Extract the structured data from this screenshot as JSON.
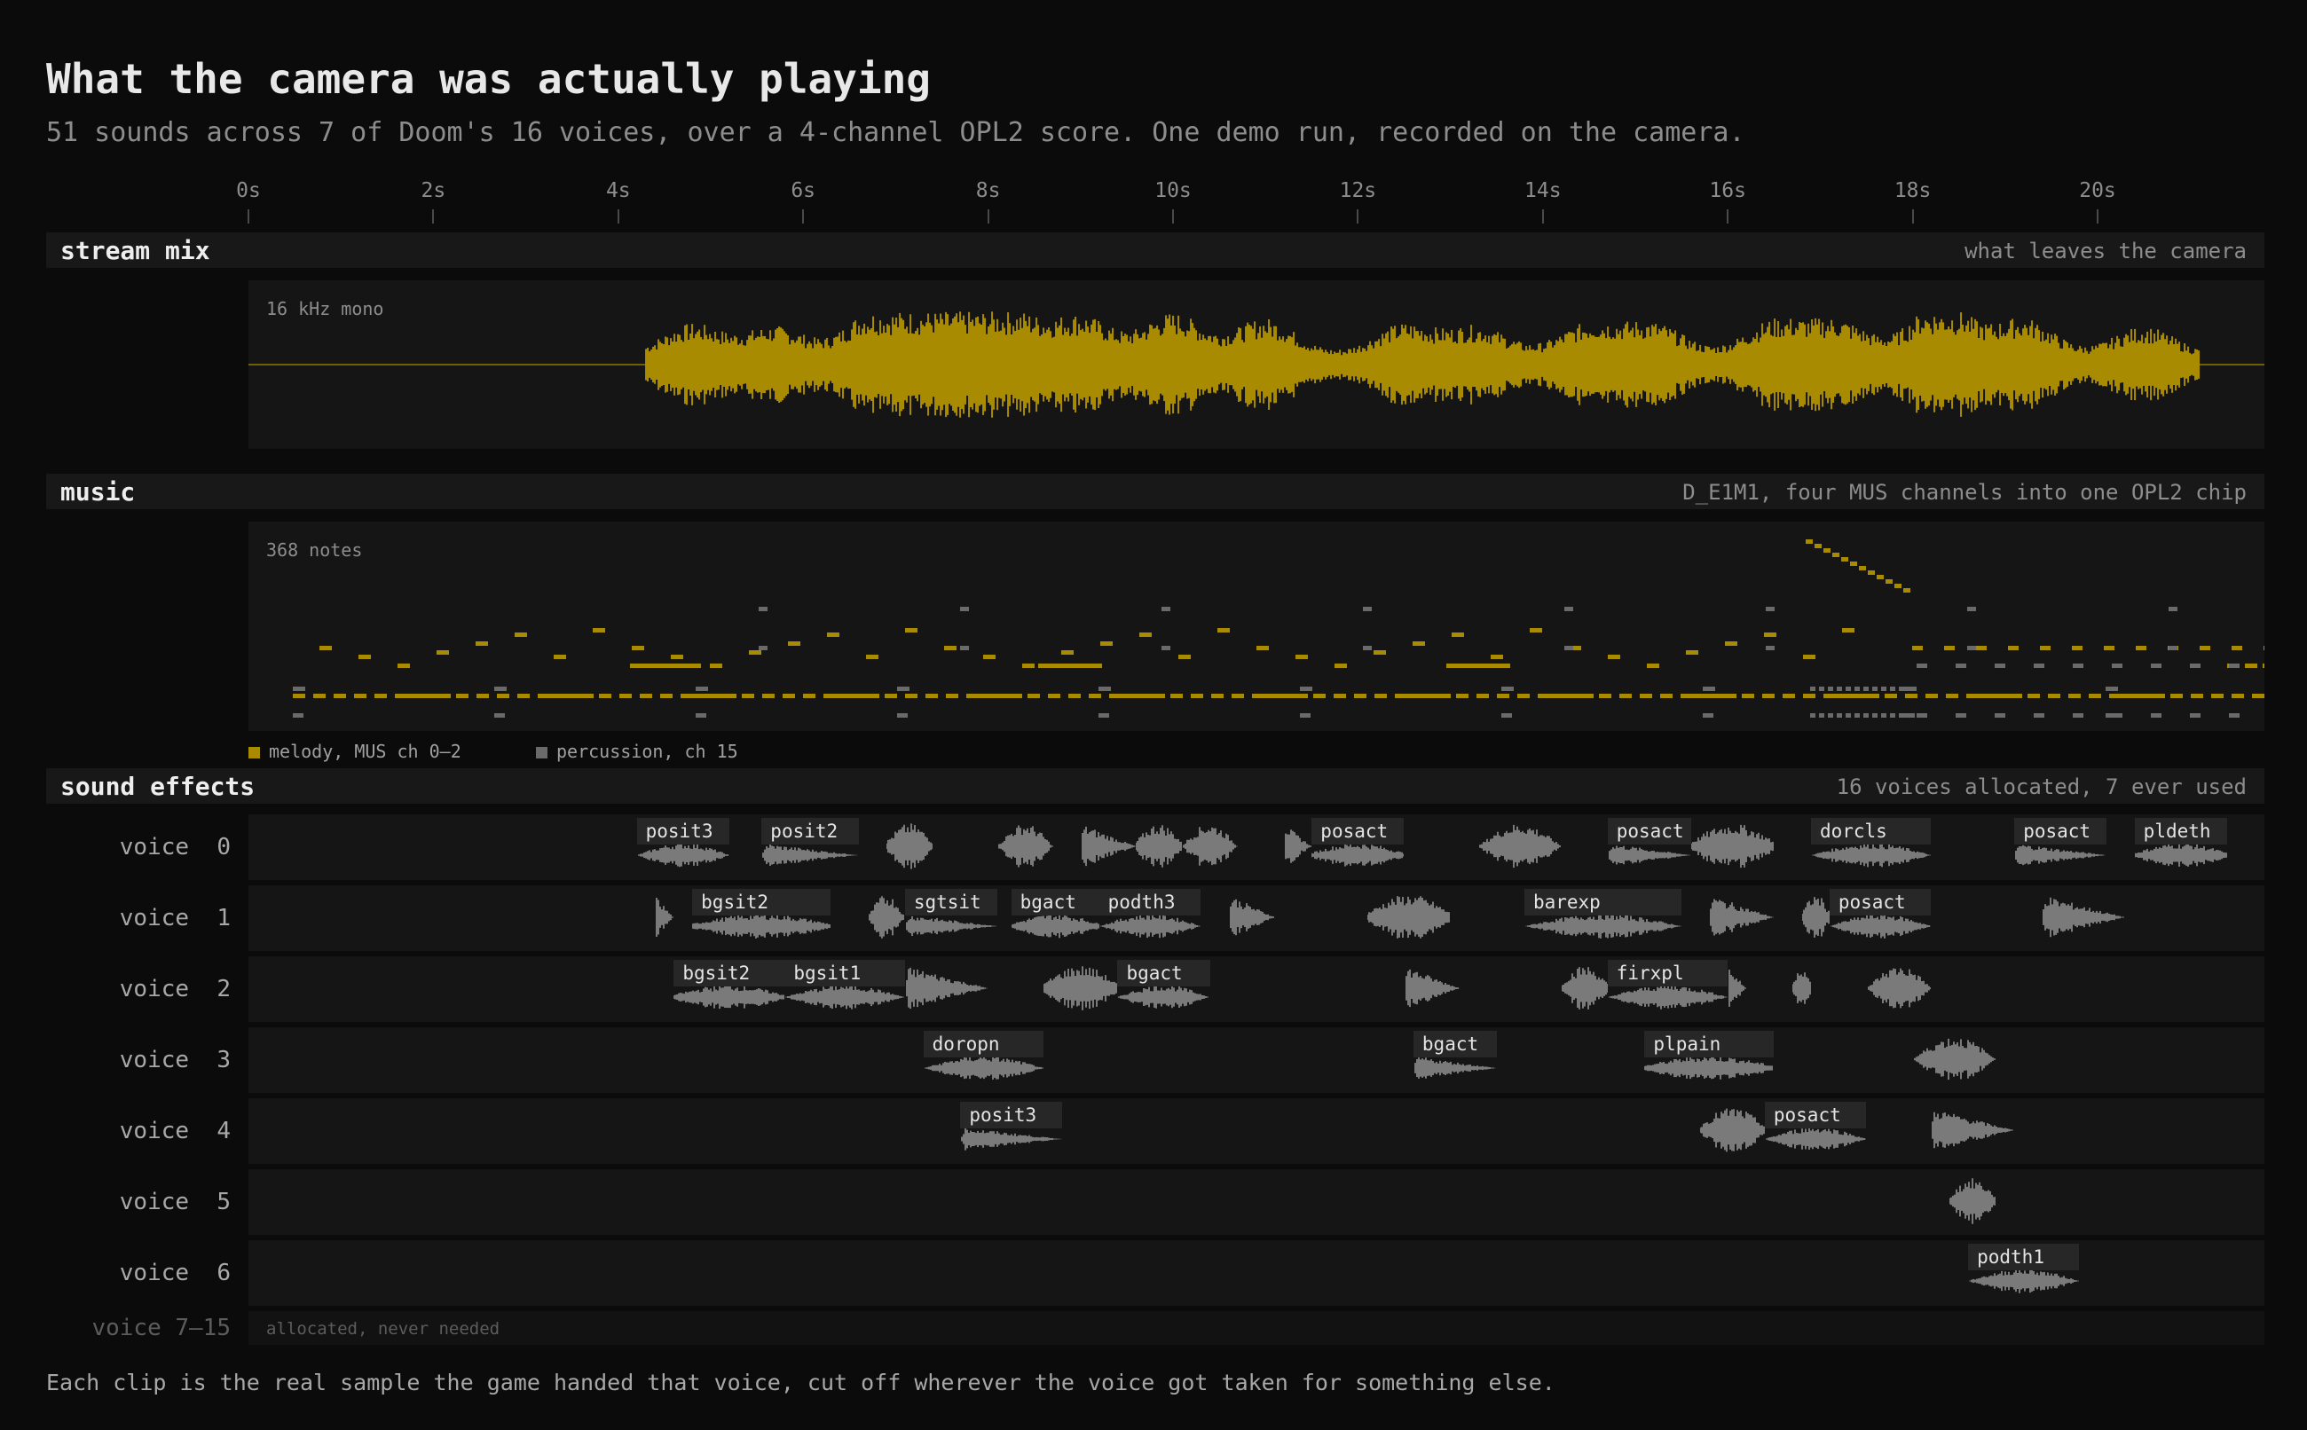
{
  "title": "What the camera was actually playing",
  "subtitle": "51 sounds across 7 of Doom's 16 voices, over a 4-channel OPL2 score. One demo run, recorded on the camera.",
  "colors": {
    "accent": "#a88b00",
    "percussion": "#6a6a6a",
    "clip": "#7a7a7a",
    "background": "#0b0b0b"
  },
  "timeline": {
    "ticks": [
      {
        "t": 0,
        "label": "0s"
      },
      {
        "t": 2,
        "label": "2s"
      },
      {
        "t": 4,
        "label": "4s"
      },
      {
        "t": 6,
        "label": "6s"
      },
      {
        "t": 8,
        "label": "8s"
      },
      {
        "t": 10,
        "label": "10s"
      },
      {
        "t": 12,
        "label": "12s"
      },
      {
        "t": 14,
        "label": "14s"
      },
      {
        "t": 16,
        "label": "16s"
      },
      {
        "t": 18,
        "label": "18s"
      },
      {
        "t": 20,
        "label": "20s"
      }
    ],
    "duration_s": 21.85
  },
  "stream_mix": {
    "name": "stream mix",
    "note": "what leaves the camera",
    "format_label": "16 kHz mono",
    "sound_start_s": 4.3,
    "sound_end_s": 21.1
  },
  "music": {
    "name": "music",
    "note": "D_E1M1, four MUS channels into one OPL2 chip",
    "count_label": "368 notes",
    "legend_melody": "melody, MUS ch 0–2",
    "legend_percussion": "percussion, ch 15"
  },
  "sound_effects": {
    "name": "sound effects",
    "note": "16 voices allocated, 7 ever used",
    "voices": [
      {
        "label": "voice  0",
        "clips": [
          {
            "start": 4.2,
            "end": 5.2,
            "name": "posit3"
          },
          {
            "start": 5.55,
            "end": 6.6,
            "name": "posit2"
          },
          {
            "start": 6.9,
            "end": 7.4,
            "name": ""
          },
          {
            "start": 8.1,
            "end": 8.7,
            "name": ""
          },
          {
            "start": 9.0,
            "end": 9.6,
            "name": ""
          },
          {
            "start": 9.6,
            "end": 10.1,
            "name": ""
          },
          {
            "start": 10.1,
            "end": 10.7,
            "name": ""
          },
          {
            "start": 11.2,
            "end": 11.5,
            "name": ""
          },
          {
            "start": 11.5,
            "end": 12.5,
            "name": "posact"
          },
          {
            "start": 13.3,
            "end": 14.2,
            "name": ""
          },
          {
            "start": 14.7,
            "end": 15.6,
            "name": "posact"
          },
          {
            "start": 15.6,
            "end": 16.5,
            "name": ""
          },
          {
            "start": 16.9,
            "end": 18.2,
            "name": "dorcls"
          },
          {
            "start": 19.1,
            "end": 20.1,
            "name": "posact"
          },
          {
            "start": 20.4,
            "end": 21.4,
            "name": "pldeth"
          }
        ]
      },
      {
        "label": "voice  1",
        "clips": [
          {
            "start": 4.4,
            "end": 4.6,
            "name": ""
          },
          {
            "start": 4.8,
            "end": 6.3,
            "name": "bgsit2"
          },
          {
            "start": 6.7,
            "end": 7.1,
            "name": ""
          },
          {
            "start": 7.1,
            "end": 8.1,
            "name": "sgtsit"
          },
          {
            "start": 8.25,
            "end": 9.2,
            "name": "bgact"
          },
          {
            "start": 9.2,
            "end": 10.3,
            "name": "podth3"
          },
          {
            "start": 10.6,
            "end": 11.1,
            "name": ""
          },
          {
            "start": 12.1,
            "end": 13.0,
            "name": ""
          },
          {
            "start": 13.8,
            "end": 15.5,
            "name": "barexp"
          },
          {
            "start": 15.8,
            "end": 16.5,
            "name": ""
          },
          {
            "start": 16.8,
            "end": 17.1,
            "name": ""
          },
          {
            "start": 17.1,
            "end": 18.2,
            "name": "posact"
          },
          {
            "start": 19.4,
            "end": 20.3,
            "name": ""
          }
        ]
      },
      {
        "label": "voice  2",
        "clips": [
          {
            "start": 4.6,
            "end": 5.8,
            "name": "bgsit2"
          },
          {
            "start": 5.8,
            "end": 7.1,
            "name": "bgsit1"
          },
          {
            "start": 7.1,
            "end": 8.0,
            "name": ""
          },
          {
            "start": 8.6,
            "end": 9.4,
            "name": ""
          },
          {
            "start": 9.4,
            "end": 10.4,
            "name": "bgact"
          },
          {
            "start": 12.5,
            "end": 13.1,
            "name": ""
          },
          {
            "start": 14.2,
            "end": 14.7,
            "name": ""
          },
          {
            "start": 14.7,
            "end": 16.0,
            "name": "firxpl"
          },
          {
            "start": 16.0,
            "end": 16.2,
            "name": ""
          },
          {
            "start": 16.7,
            "end": 16.9,
            "name": ""
          },
          {
            "start": 17.5,
            "end": 18.2,
            "name": ""
          }
        ]
      },
      {
        "label": "voice  3",
        "clips": [
          {
            "start": 7.3,
            "end": 8.6,
            "name": "doropn"
          },
          {
            "start": 12.6,
            "end": 13.5,
            "name": "bgact"
          },
          {
            "start": 15.1,
            "end": 16.5,
            "name": "plpain"
          },
          {
            "start": 18.0,
            "end": 18.9,
            "name": ""
          }
        ]
      },
      {
        "label": "voice  4",
        "clips": [
          {
            "start": 7.7,
            "end": 8.8,
            "name": "posit3"
          },
          {
            "start": 15.7,
            "end": 16.4,
            "name": ""
          },
          {
            "start": 16.4,
            "end": 17.5,
            "name": "posact"
          },
          {
            "start": 18.2,
            "end": 19.1,
            "name": ""
          }
        ]
      },
      {
        "label": "voice  5",
        "clips": [
          {
            "start": 18.4,
            "end": 18.9,
            "name": ""
          }
        ]
      },
      {
        "label": "voice  6",
        "clips": [
          {
            "start": 18.6,
            "end": 19.8,
            "name": "podth1"
          }
        ]
      }
    ],
    "unused_label": "voice 7–15",
    "unused_note": "allocated, never needed"
  },
  "footer": "Each clip is the real sample the game handed that voice, cut off wherever the voice got taken for something else."
}
